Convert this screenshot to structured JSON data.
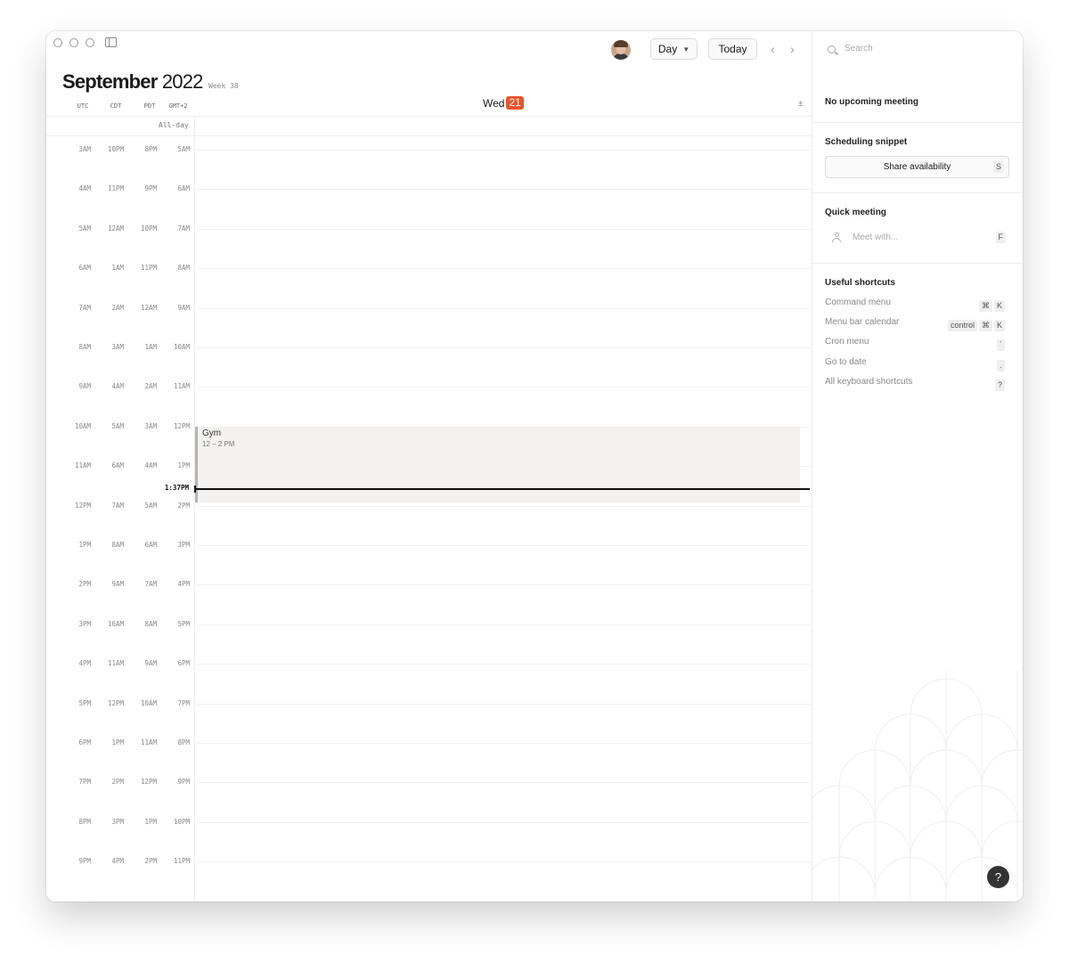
{
  "toolbar": {
    "view_label": "Day",
    "today_label": "Today",
    "prev_label": "‹",
    "next_label": "›"
  },
  "header": {
    "month": "September",
    "year": "2022",
    "week": "Week 38"
  },
  "timezones": [
    "UTC",
    "CDT",
    "PDT",
    "GMT+2"
  ],
  "day": {
    "name": "Wed",
    "number": "21"
  },
  "allday_label": "All-day",
  "plus_minus_label": "±",
  "time_rows": [
    [
      "3AM",
      "10PM",
      "8PM",
      "5AM"
    ],
    [
      "4AM",
      "11PM",
      "9PM",
      "6AM"
    ],
    [
      "5AM",
      "12AM",
      "10PM",
      "7AM"
    ],
    [
      "6AM",
      "1AM",
      "11PM",
      "8AM"
    ],
    [
      "7AM",
      "2AM",
      "12AM",
      "9AM"
    ],
    [
      "8AM",
      "3AM",
      "1AM",
      "10AM"
    ],
    [
      "9AM",
      "4AM",
      "2AM",
      "11AM"
    ],
    [
      "10AM",
      "5AM",
      "3AM",
      "12PM"
    ],
    [
      "11AM",
      "6AM",
      "4AM",
      "1PM"
    ],
    [
      "12PM",
      "7AM",
      "5AM",
      "2PM"
    ],
    [
      "1PM",
      "8AM",
      "6AM",
      "3PM"
    ],
    [
      "2PM",
      "9AM",
      "7AM",
      "4PM"
    ],
    [
      "3PM",
      "10AM",
      "8AM",
      "5PM"
    ],
    [
      "4PM",
      "11AM",
      "9AM",
      "6PM"
    ],
    [
      "5PM",
      "12PM",
      "10AM",
      "7PM"
    ],
    [
      "6PM",
      "1PM",
      "11AM",
      "8PM"
    ],
    [
      "7PM",
      "2PM",
      "12PM",
      "9PM"
    ],
    [
      "8PM",
      "3PM",
      "1PM",
      "10PM"
    ],
    [
      "9PM",
      "4PM",
      "2PM",
      "11PM"
    ]
  ],
  "event": {
    "title": "Gym",
    "time": "12 – 2 PM"
  },
  "now": {
    "label": "1:37PM"
  },
  "panel": {
    "search_placeholder": "Search",
    "upcoming": "No upcoming meeting",
    "scheduling_title": "Scheduling snippet",
    "share_label": "Share availability",
    "share_key": "S",
    "quick_title": "Quick meeting",
    "meet_placeholder": "Meet with...",
    "meet_key": "F",
    "shortcuts_title": "Useful shortcuts",
    "shortcuts": [
      {
        "label": "Command menu",
        "keys": [
          "⌘",
          "K"
        ]
      },
      {
        "label": "Menu bar calendar",
        "keys": [
          "control",
          "⌘",
          "K"
        ]
      },
      {
        "label": "Cron menu",
        "keys": [
          "`"
        ]
      },
      {
        "label": "Go to date",
        "keys": [
          "."
        ]
      },
      {
        "label": "All keyboard shortcuts",
        "keys": [
          "?"
        ]
      }
    ],
    "help_label": "?"
  },
  "colors": {
    "accent": "#e8552b",
    "event_bg": "#f3f2f0",
    "event_bar": "#b5b5b5",
    "now_line": "#111111"
  }
}
